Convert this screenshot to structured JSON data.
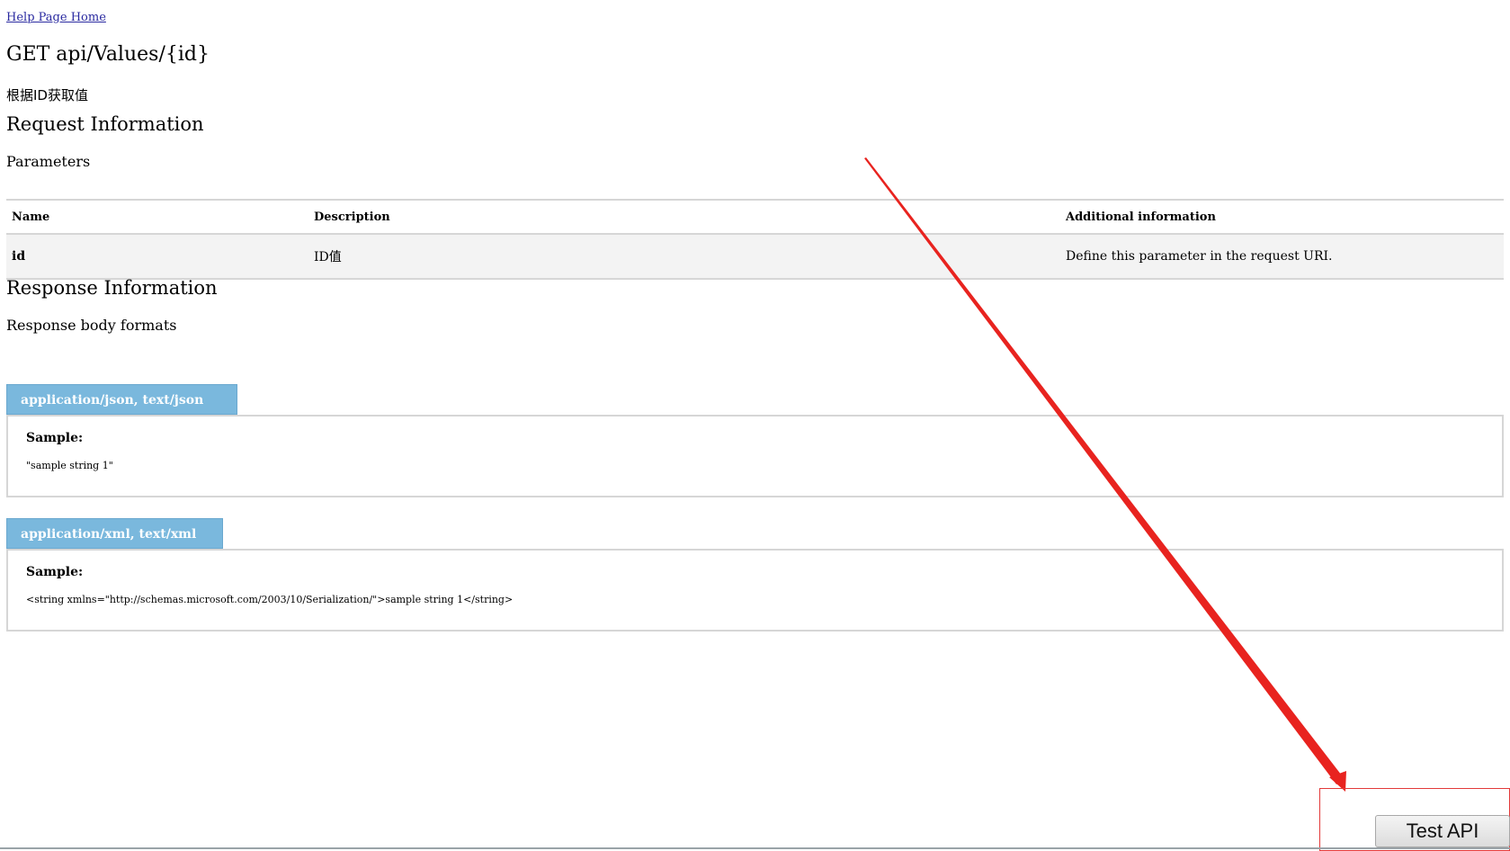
{
  "nav": {
    "home_link": "Help Page Home"
  },
  "endpoint": {
    "title": "GET api/Values/{id}",
    "description": "根据ID获取值"
  },
  "request": {
    "heading": "Request Information",
    "parameters_heading": "Parameters",
    "table": {
      "headers": [
        "Name",
        "Description",
        "Additional information"
      ],
      "rows": [
        {
          "name": "id",
          "description": "ID值",
          "additional": "Define this parameter in the request URI."
        }
      ]
    }
  },
  "response": {
    "heading": "Response Information",
    "formats_heading": "Response body formats",
    "formats": [
      {
        "tab": "application/json, text/json",
        "sample_label": "Sample:",
        "sample": "\"sample string 1\""
      },
      {
        "tab": "application/xml, text/xml",
        "sample_label": "Sample:",
        "sample": "<string xmlns=\"http://schemas.microsoft.com/2003/10/Serialization/\">sample string 1</string>"
      }
    ]
  },
  "test_button": {
    "label": "Test API"
  },
  "colors": {
    "tab_bg": "#7ab8dd",
    "annotation": "#e8231f",
    "link": "#2a2aa0"
  }
}
